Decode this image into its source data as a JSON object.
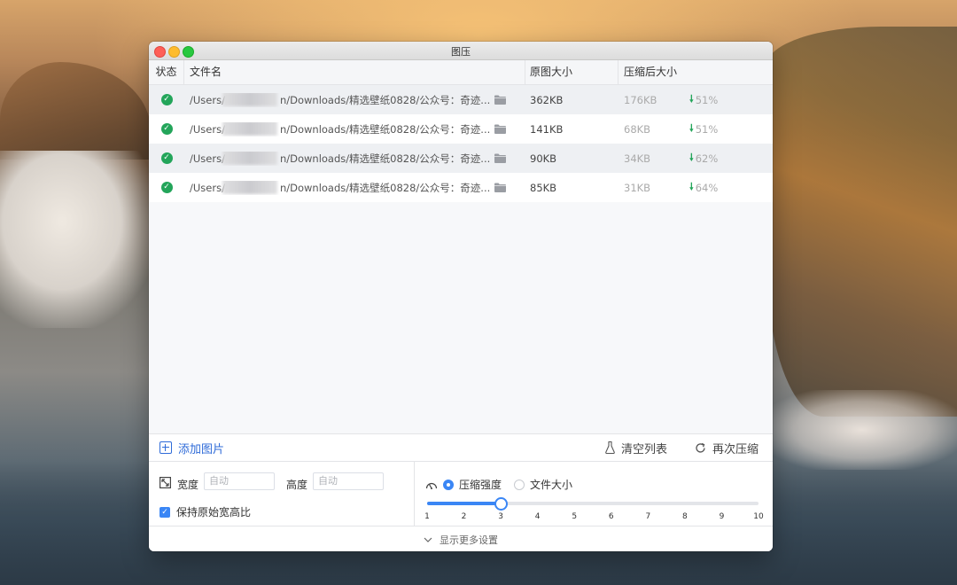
{
  "window": {
    "title": "图压"
  },
  "table": {
    "headers": {
      "status": "状态",
      "name": "文件名",
      "original": "原图大小",
      "compressed": "压缩后大小"
    },
    "rows": [
      {
        "path_prefix": "/Users/",
        "path_suffix": "n/Downloads/精选壁纸0828/公众号：奇迹...",
        "original": "362KB",
        "compressed": "176KB",
        "percent": "51%"
      },
      {
        "path_prefix": "/Users/",
        "path_suffix": "n/Downloads/精选壁纸0828/公众号：奇迹...",
        "original": "141KB",
        "compressed": "68KB",
        "percent": "51%"
      },
      {
        "path_prefix": "/Users/",
        "path_suffix": "n/Downloads/精选壁纸0828/公众号：奇迹...",
        "original": "90KB",
        "compressed": "34KB",
        "percent": "62%"
      },
      {
        "path_prefix": "/Users/",
        "path_suffix": "n/Downloads/精选壁纸0828/公众号：奇迹...",
        "original": "85KB",
        "compressed": "31KB",
        "percent": "64%"
      }
    ]
  },
  "actions": {
    "add": "添加图片",
    "clear": "清空列表",
    "recompress": "再次压缩"
  },
  "settings": {
    "width_label": "宽度",
    "width_placeholder": "自动",
    "height_label": "高度",
    "height_placeholder": "自动",
    "keep_ratio": "保持原始宽高比",
    "keep_ratio_checked": true,
    "mode_strength": "压缩强度",
    "mode_filesize": "文件大小",
    "mode_selected": "strength",
    "slider_value": 3,
    "slider_min": 1,
    "slider_max": 10,
    "slider_ticks": [
      "1",
      "2",
      "3",
      "4",
      "5",
      "6",
      "7",
      "8",
      "9",
      "10"
    ]
  },
  "footer": {
    "more": "显示更多设置"
  },
  "colors": {
    "accent": "#3a86f5",
    "success": "#23a55a",
    "link": "#2f6bd8"
  }
}
